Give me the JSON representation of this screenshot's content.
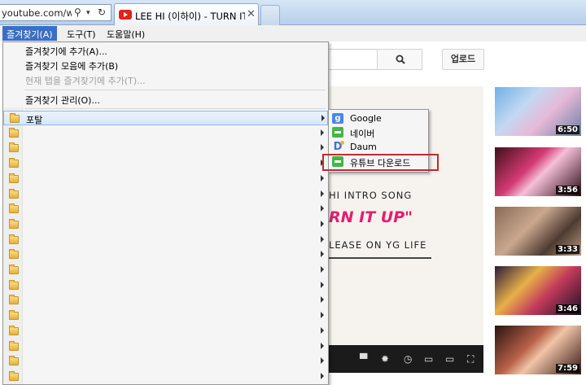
{
  "browser": {
    "address": "youtube.com/watc",
    "tab_title": "LEE HI (이하이) - TURN IT ...",
    "tab_close": "✕"
  },
  "menubar": {
    "favorites": "즐겨찾기(A)",
    "tools": "도구(T)",
    "help": "도움말(H)"
  },
  "page": {
    "upload": "업로드",
    "promo_line1": "HI INTRO SONG",
    "promo_line2": "RN IT UP\"",
    "promo_line3": "LEASE ON YG LIFE",
    "thumbnails": [
      {
        "duration": "6:50"
      },
      {
        "duration": "3:56"
      },
      {
        "duration": "3:33"
      },
      {
        "duration": "3:46"
      },
      {
        "duration": "7:59"
      }
    ]
  },
  "favorites_menu": {
    "add": "즐겨찾기에 추가(A)...",
    "add_to_bar": "즐겨찾기 모음에 추가(B)",
    "add_tabs": "현재 탭을 즐겨찾기에 추가(T)...",
    "manage": "즐겨찾기 관리(O)...",
    "folders": [
      {
        "label": "포탈",
        "highlighted": true
      },
      {
        "label": ""
      },
      {
        "label": ""
      },
      {
        "label": ""
      },
      {
        "label": ""
      },
      {
        "label": ""
      },
      {
        "label": ""
      },
      {
        "label": ""
      },
      {
        "label": ""
      },
      {
        "label": ""
      },
      {
        "label": ""
      },
      {
        "label": ""
      },
      {
        "label": ""
      },
      {
        "label": ""
      },
      {
        "label": ""
      },
      {
        "label": ""
      },
      {
        "label": ""
      },
      {
        "label": ""
      }
    ]
  },
  "portal_submenu": {
    "items": [
      {
        "label": "Google",
        "icon": "google-icon"
      },
      {
        "label": "네이버",
        "icon": "naver-icon"
      },
      {
        "label": "Daum",
        "icon": "daum-icon"
      },
      {
        "label": "유튜브 다운로드",
        "icon": "green-bookmark-icon"
      }
    ]
  },
  "colors": {
    "menu_highlight": "#3a6fc4",
    "annotation_box": "#c5282c"
  }
}
